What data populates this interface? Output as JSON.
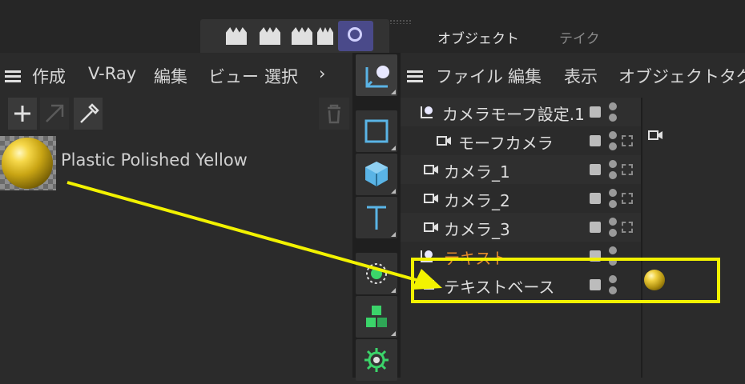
{
  "tabs": {
    "object": "オブジェクト",
    "take": "テイク"
  },
  "left_menu": {
    "create": "作成",
    "vray": "V-Ray",
    "edit": "編集",
    "view": "ビュー",
    "select": "選択",
    "more": "›"
  },
  "material": {
    "name": "Plastic Polished Yellow"
  },
  "om_menu": {
    "file": "ファイル",
    "edit": "編集",
    "display": "表示",
    "object": "オブジェクト",
    "tag": "タグ"
  },
  "objects": [
    {
      "name": "カメラモーフ設定.1"
    },
    {
      "name": "モーフカメラ"
    },
    {
      "name": "カメラ_1"
    },
    {
      "name": "カメラ_2"
    },
    {
      "name": "カメラ_3"
    },
    {
      "name": "テキスト"
    },
    {
      "name": "テキストベース"
    }
  ],
  "colors": {
    "highlight": "#f2f200",
    "arrow": "#f2f200",
    "text_object": "#e38a2a",
    "accent": "#5ab4e6"
  },
  "icons": [
    "hamburger-icon",
    "plus-icon",
    "arrow-icon",
    "eyedropper-icon",
    "trash-icon",
    "cube-icon",
    "text-icon",
    "camera-icon",
    "clapper-icon"
  ]
}
